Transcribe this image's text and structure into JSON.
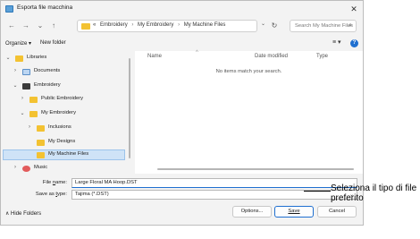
{
  "window": {
    "title": "Esporta file macchina",
    "close_glyph": "✕"
  },
  "nav": {
    "back": "←",
    "forward": "→",
    "up_dropdown": "⌄",
    "up": "↑",
    "address_overflow": "«",
    "address_parts": [
      "Embroidery",
      "My Embroidery",
      "My Machine Files"
    ],
    "address_sep": "›",
    "dropdown_glyph": "⌄",
    "refresh_glyph": "↻",
    "search_placeholder": "Search My Machine Files",
    "search_glyph": "⌕"
  },
  "toolbar": {
    "organize": "Organize ▾",
    "new_folder": "New folder",
    "view": "≡ ▾",
    "help": "?"
  },
  "sidebar": {
    "items": [
      {
        "label": "Libraries",
        "chev": "⌄",
        "icon": "folder-icon"
      },
      {
        "label": "Documents",
        "chev": "›",
        "icon": "document-icon"
      },
      {
        "label": "Embroidery",
        "chev": "⌄",
        "icon": "computer-icon"
      },
      {
        "label": "Public Embroidery",
        "chev": "›",
        "icon": "folder-icon"
      },
      {
        "label": "My Embroidery",
        "chev": "⌄",
        "icon": "folder-icon"
      },
      {
        "label": "Inclusions",
        "chev": "›",
        "icon": "folder-icon"
      },
      {
        "label": "My Designs",
        "chev": "",
        "icon": "folder-icon"
      },
      {
        "label": "My Machine Files",
        "chev": "",
        "icon": "folder-icon",
        "selected": true
      },
      {
        "label": "Music",
        "chev": "›",
        "icon": "music-icon"
      }
    ]
  },
  "filelist": {
    "columns": [
      "Name",
      "Date modified",
      "Type"
    ],
    "sort_glyph": "^",
    "empty_message": "No items match your search."
  },
  "form": {
    "filename_label_pre": "File ",
    "filename_label_u": "n",
    "filename_label_post": "ame:",
    "filename_value": "Large Floral MA Hoop.DST",
    "savetype_label_pre": "Save as ",
    "savetype_label_u": "t",
    "savetype_label_post": "ype:",
    "savetype_value": "Tajima (*.DST)",
    "savetype_chev": "⌄",
    "hide_folders": "∧  Hide Folders",
    "options_button": "Options...",
    "save_button": "Save",
    "cancel_button": "Cancel"
  },
  "callout": {
    "text": "Seleziona il tipo di file preferito"
  },
  "colors": {
    "accent": "#1f6fd0",
    "folder": "#f3c232",
    "selection": "#cfe3f7"
  }
}
